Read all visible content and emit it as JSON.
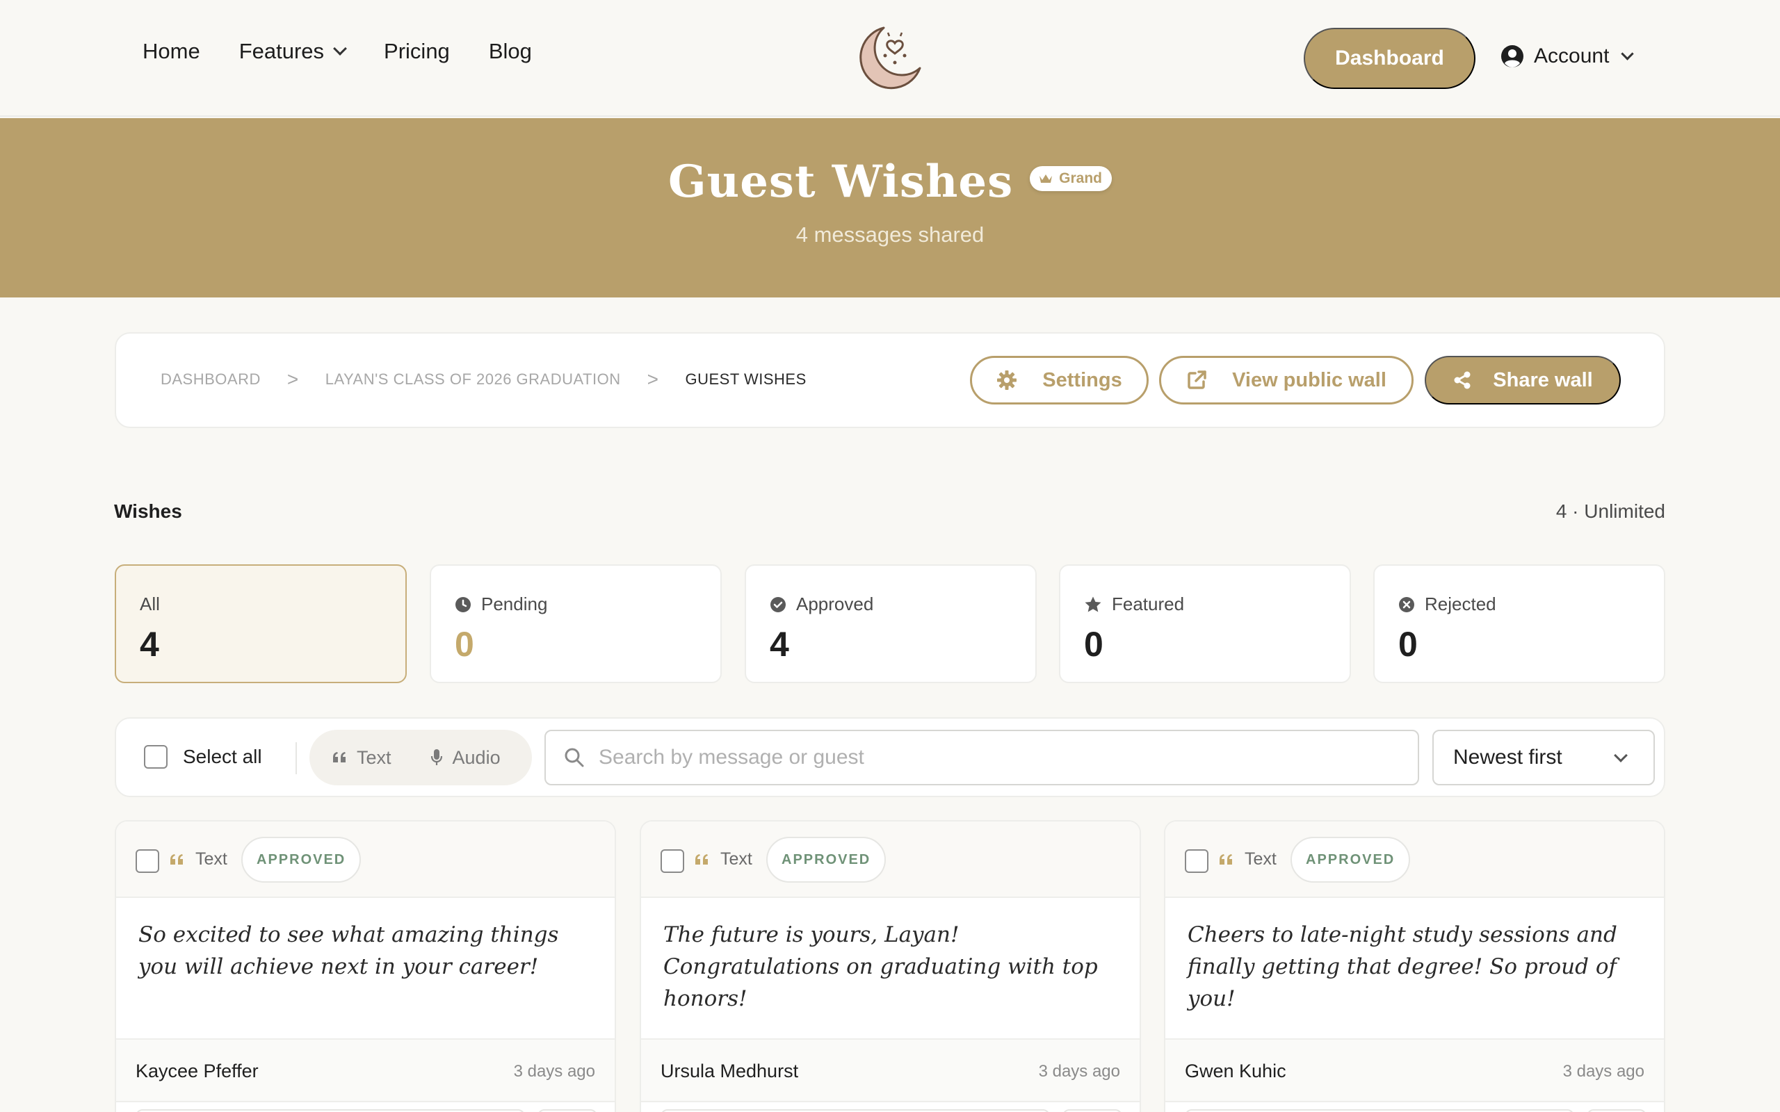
{
  "nav": {
    "home": "Home",
    "features": "Features",
    "pricing": "Pricing",
    "blog": "Blog",
    "dashboard": "Dashboard",
    "account": "Account"
  },
  "hero": {
    "title": "Guest Wishes",
    "badge": "Grand",
    "subtitle": "4 messages shared"
  },
  "breadcrumb": {
    "items": [
      "DASHBOARD",
      "LAYAN'S CLASS OF 2026 GRADUATION",
      "GUEST WISHES"
    ],
    "separator": ">"
  },
  "actions": {
    "settings": "Settings",
    "view_public": "View public wall",
    "share": "Share wall"
  },
  "wishes": {
    "label": "Wishes",
    "count": "4 · Unlimited"
  },
  "stats": [
    {
      "label": "All",
      "value": "4",
      "icon": "none"
    },
    {
      "label": "Pending",
      "value": "0",
      "icon": "clock-icon"
    },
    {
      "label": "Approved",
      "value": "4",
      "icon": "check-circle-icon"
    },
    {
      "label": "Featured",
      "value": "0",
      "icon": "star-icon"
    },
    {
      "label": "Rejected",
      "value": "0",
      "icon": "x-circle-icon"
    }
  ],
  "filters": {
    "select_all": "Select all",
    "type_text": "Text",
    "type_audio": "Audio",
    "search_placeholder": "Search by message or guest",
    "sort": "Newest first"
  },
  "cards": [
    {
      "type": "Text",
      "status": "APPROVED",
      "message": "So excited to see what amazing things you will achieve next in your career!",
      "author": "Kaycee Pfeffer",
      "time": "3 days ago"
    },
    {
      "type": "Text",
      "status": "APPROVED",
      "message": "The future is yours, Layan! Congratulations on graduating with top honors!",
      "author": "Ursula Medhurst",
      "time": "3 days ago"
    },
    {
      "type": "Text",
      "status": "APPROVED",
      "message": "Cheers to late-night study sessions and finally getting that degree! So proud of you!",
      "author": "Gwen Kuhic",
      "time": "3 days ago"
    }
  ],
  "colors": {
    "accent": "#b89f6b",
    "background": "#f9f8f4",
    "approved": "#6f9277"
  }
}
